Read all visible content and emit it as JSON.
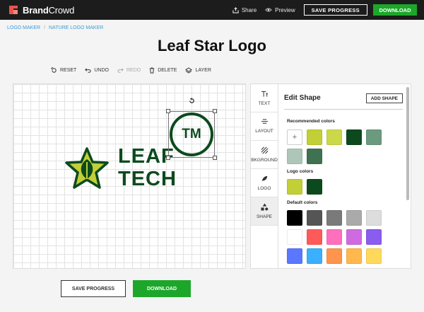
{
  "header": {
    "brand_bold": "Brand",
    "brand_light": "Crowd",
    "share_label": "Share",
    "preview_label": "Preview",
    "save_progress_label": "SAVE PROGRESS",
    "download_label": "DOWNLOAD"
  },
  "breadcrumb": {
    "items": [
      "LOGO MAKER",
      "NATURE LOGO MAKER"
    ],
    "separator": "/"
  },
  "page_title": "Leaf Star Logo",
  "toolbar": {
    "reset": "RESET",
    "undo": "UNDO",
    "redo": "REDO",
    "delete": "DELETE",
    "layer": "LAYER"
  },
  "canvas": {
    "line1": "LEAF",
    "line2": "TECH",
    "tm_text": "TM"
  },
  "side_tabs": [
    "TEXT",
    "LAYOUT",
    "BKGROUND",
    "LOGO",
    "SHAPE"
  ],
  "panel": {
    "title": "Edit Shape",
    "add_shape_label": "ADD SHAPE",
    "recommended_label": "Recommended colors",
    "logo_label": "Logo colors",
    "default_label": "Default colors",
    "add_symbol": "+",
    "recommended_colors": [
      "#c2cf36",
      "#cbd84a",
      "#0c4a1e",
      "#6b9a7f",
      "#aec6b8",
      "#3e7250"
    ],
    "logo_colors": [
      "#c2cf36",
      "#0c4a1e"
    ],
    "default_colors": [
      "#000000",
      "#555555",
      "#7a7a7a",
      "#aaaaaa",
      "#dddddd",
      "#ffffff",
      "#ff5a5a",
      "#ff6fbd",
      "#cf6be0",
      "#8a5cf0",
      "#5a78ff",
      "#3ab0ff",
      "#ff944d",
      "#ffb84d",
      "#ffd95a"
    ]
  },
  "bottom": {
    "save_progress_label": "SAVE PROGRESS",
    "download_label": "DOWNLOAD"
  },
  "colors": {
    "topbar": "#1c1c1c",
    "accent_green": "#1da72a",
    "logo_dark_green": "#0c4a1e",
    "logo_lime": "#c2cf36",
    "link_blue": "#3a9bd8"
  }
}
